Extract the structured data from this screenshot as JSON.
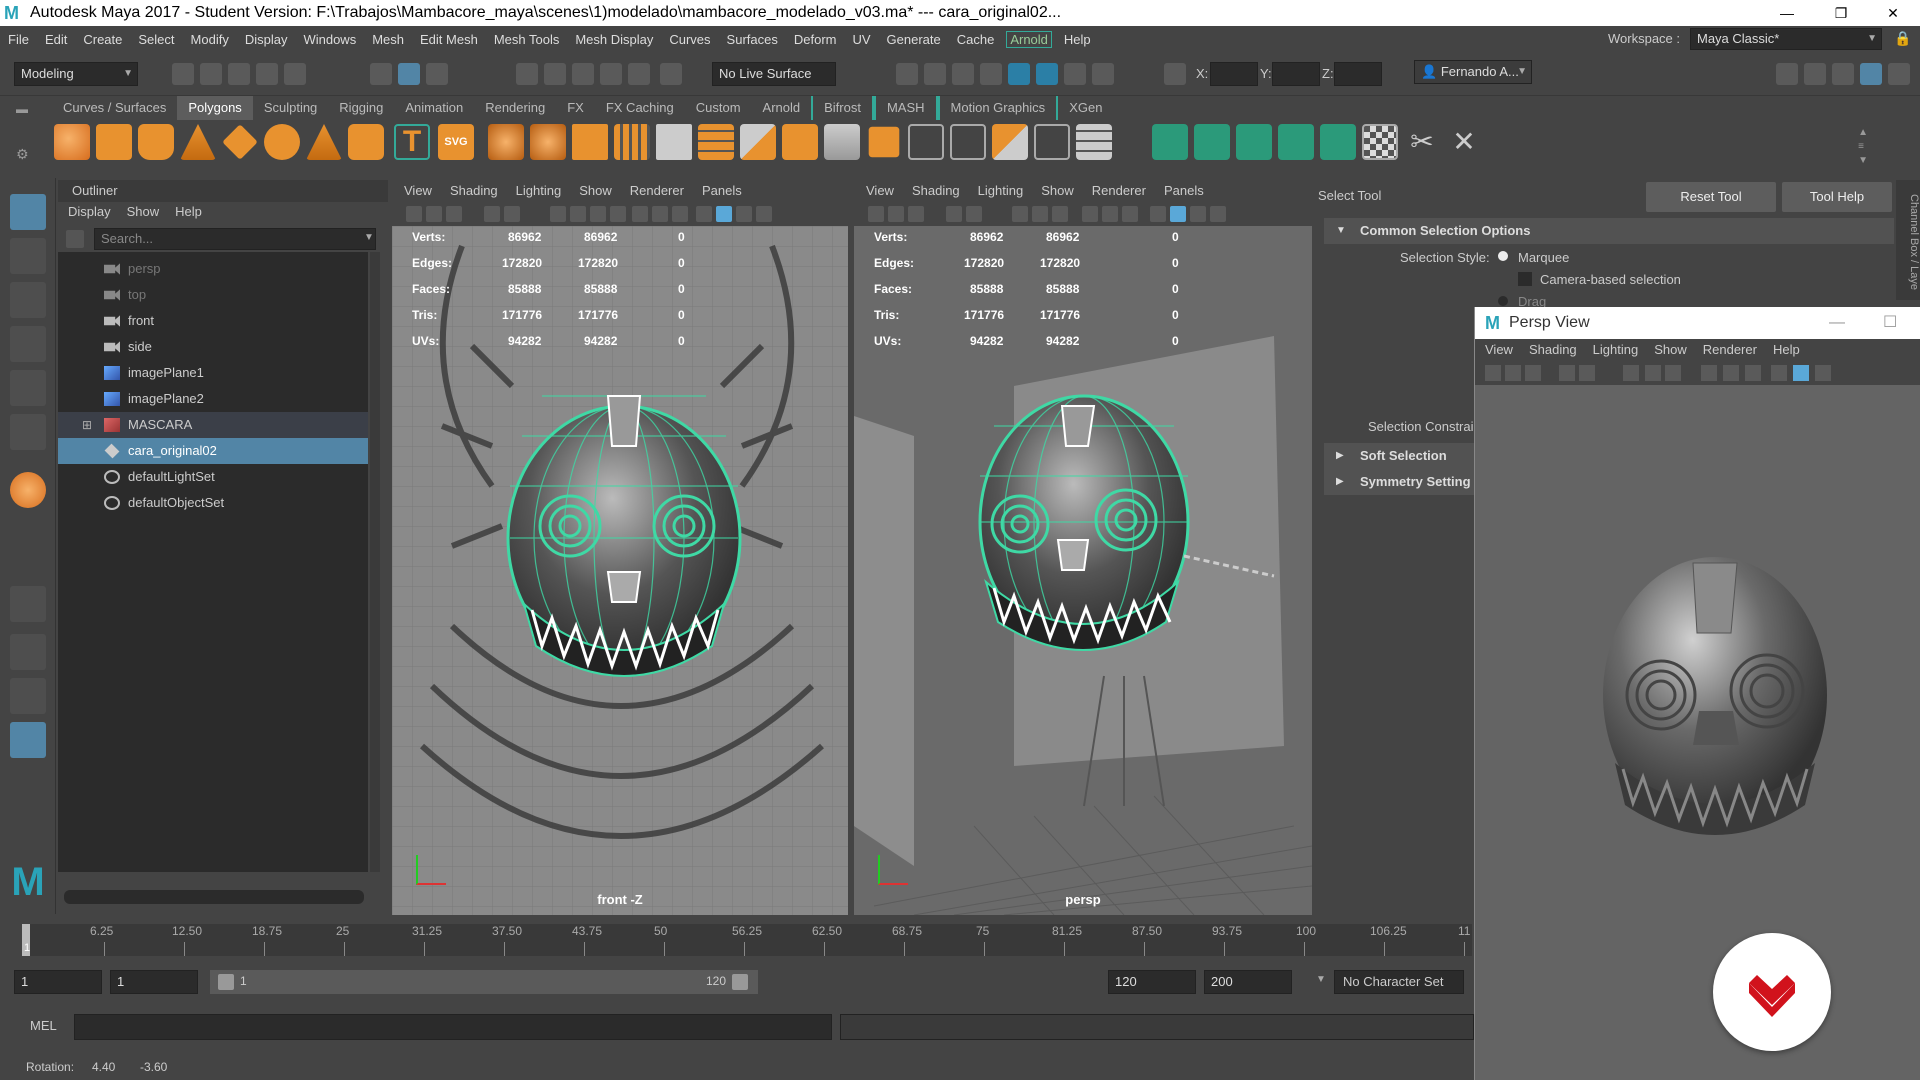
{
  "window": {
    "title": "Autodesk Maya 2017 - Student Version: F:\\Trabajos\\Mambacore_maya\\scenes\\1)modelado\\mambacore_modelado_v03.ma*   ---   cara_original02...",
    "app_icon": "maya-logo",
    "minimize": "—",
    "restore": "❐",
    "close": "✕"
  },
  "menubar": {
    "items": [
      "File",
      "Edit",
      "Create",
      "Select",
      "Modify",
      "Display",
      "Windows",
      "Mesh",
      "Edit Mesh",
      "Mesh Tools",
      "Mesh Display",
      "Curves",
      "Surfaces",
      "Deform",
      "UV",
      "Generate",
      "Cache",
      "Arnold",
      "Help"
    ],
    "workspace_label": "Workspace :",
    "workspace_value": "Maya Classic*"
  },
  "statusline": {
    "menuset": "Modeling",
    "live_surface": "No Live Surface",
    "x_label": "X:",
    "y_label": "Y:",
    "z_label": "Z:",
    "user": "Fernando A..."
  },
  "shelf": {
    "tabs": [
      "Curves / Surfaces",
      "Polygons",
      "Sculpting",
      "Rigging",
      "Animation",
      "Rendering",
      "FX",
      "FX Caching",
      "Custom",
      "Arnold",
      "Bifrost",
      "MASH",
      "Motion Graphics",
      "XGen"
    ],
    "active_tab": "Polygons"
  },
  "outliner": {
    "title": "Outliner",
    "menu": [
      "Display",
      "Show",
      "Help"
    ],
    "search_placeholder": "Search...",
    "items": [
      {
        "label": "persp",
        "icon": "camera-icon",
        "dim": true
      },
      {
        "label": "top",
        "icon": "camera-icon",
        "dim": true
      },
      {
        "label": "front",
        "icon": "camera-icon",
        "dim": false
      },
      {
        "label": "side",
        "icon": "camera-icon",
        "dim": false
      },
      {
        "label": "imagePlane1",
        "icon": "image-plane-icon",
        "dim": false
      },
      {
        "label": "imagePlane2",
        "icon": "image-plane-icon",
        "dim": false
      },
      {
        "label": "MASCARA",
        "icon": "group-icon",
        "dim": false
      },
      {
        "label": "cara_original02",
        "icon": "mesh-icon",
        "dim": false
      },
      {
        "label": "defaultLightSet",
        "icon": "set-icon",
        "dim": false
      },
      {
        "label": "defaultObjectSet",
        "icon": "set-icon",
        "dim": false
      }
    ],
    "selected": "cara_original02"
  },
  "viewport_menu": [
    "View",
    "Shading",
    "Lighting",
    "Show",
    "Renderer",
    "Panels"
  ],
  "hud": {
    "rows": [
      {
        "label": "Verts:",
        "a": "86962",
        "b": "86962",
        "c": "0"
      },
      {
        "label": "Edges:",
        "a": "172820",
        "b": "172820",
        "c": "0"
      },
      {
        "label": "Faces:",
        "a": "85888",
        "b": "85888",
        "c": "0"
      },
      {
        "label": "Tris:",
        "a": "171776",
        "b": "171776",
        "c": "0"
      },
      {
        "label": "UVs:",
        "a": "94282",
        "b": "94282",
        "c": "0"
      }
    ]
  },
  "viewport_left": {
    "camera": "front -Z"
  },
  "viewport_right": {
    "camera": "persp"
  },
  "tool_settings": {
    "title": "Select Tool",
    "reset": "Reset Tool",
    "help": "Tool Help",
    "section": "Common Selection Options",
    "selection_style_label": "Selection Style:",
    "marquee": "Marquee",
    "camera_based": "Camera-based selection",
    "drag": "Drag",
    "constraint": "Selection Constrai",
    "soft": "Soft Selection",
    "symmetry": "Symmetry Setting",
    "side_tab": "Channel Box / Laye"
  },
  "persp_window": {
    "title": "Persp View",
    "menu": [
      "View",
      "Shading",
      "Lighting",
      "Show",
      "Renderer",
      "Help"
    ]
  },
  "timeline": {
    "ticks": [
      "6.25",
      "12.50",
      "18.75",
      "25",
      "31.25",
      "37.50",
      "43.75",
      "50",
      "56.25",
      "62.50",
      "68.75",
      "75",
      "81.25",
      "87.50",
      "93.75",
      "100",
      "106.25",
      "11"
    ],
    "current": "1"
  },
  "range": {
    "start": "1",
    "start2": "1",
    "slider_start": "1",
    "slider_end": "120",
    "end": "120",
    "end2": "200",
    "char_set": "No Character Set"
  },
  "mel": {
    "label": "MEL"
  },
  "help_line": {
    "label": "Rotation:",
    "v1": "4.40",
    "v2": "-3.60"
  }
}
